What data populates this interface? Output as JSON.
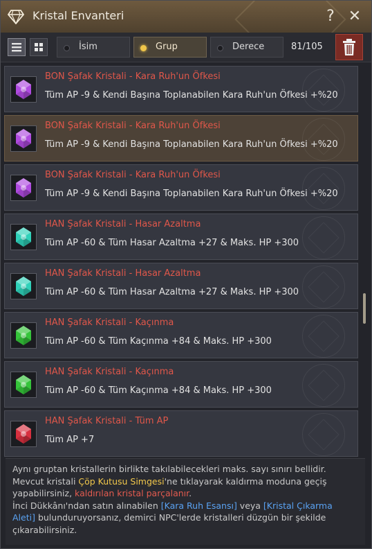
{
  "window": {
    "title": "Kristal Envanteri",
    "help_label": "?",
    "close_label": "✕"
  },
  "toolbar": {
    "view_list_icon": "list-view-icon",
    "view_grid_icon": "grid-view-icon",
    "sort_options": [
      {
        "label": "İsim",
        "selected": false
      },
      {
        "label": "Grup",
        "selected": true
      },
      {
        "label": "Derece",
        "selected": false
      }
    ],
    "count": "81/105",
    "trash_icon": "trash-icon"
  },
  "crystals": [
    {
      "name": "BON Şafak Kristali - Kara Ruh'un Öfkesi",
      "effect": "Tüm AP -9 & Kendi Başına Toplanabilen Kara Ruh'un Öfkesi +%20",
      "color": "#b04be0",
      "selected": false
    },
    {
      "name": "BON Şafak Kristali - Kara Ruh'un Öfkesi",
      "effect": "Tüm AP -9 & Kendi Başına Toplanabilen Kara Ruh'un Öfkesi +%20",
      "color": "#b04be0",
      "selected": true
    },
    {
      "name": "BON Şafak Kristali - Kara Ruh'un Öfkesi",
      "effect": "Tüm AP -9 & Kendi Başına Toplanabilen Kara Ruh'un Öfkesi +%20",
      "color": "#b04be0",
      "selected": false
    },
    {
      "name": "HAN Şafak Kristali - Hasar Azaltma",
      "effect": "Tüm AP -60 & Tüm Hasar Azaltma +27 & Maks. HP +300",
      "color": "#2fd1b9",
      "selected": false
    },
    {
      "name": "HAN Şafak Kristali - Hasar Azaltma",
      "effect": "Tüm AP -60 & Tüm Hasar Azaltma +27 & Maks. HP +300",
      "color": "#2fd1b9",
      "selected": false
    },
    {
      "name": "HAN Şafak Kristali - Kaçınma",
      "effect": "Tüm AP -60 & Tüm Kaçınma +84 & Maks. HP +300",
      "color": "#35c43a",
      "selected": false
    },
    {
      "name": "HAN Şafak Kristali - Kaçınma",
      "effect": "Tüm AP -60 & Tüm Kaçınma +84 & Maks. HP +300",
      "color": "#35c43a",
      "selected": false
    },
    {
      "name": "HAN Şafak Kristali - Tüm AP",
      "effect": "Tüm AP +7",
      "color": "#d8303f",
      "selected": false
    }
  ],
  "info": {
    "line1": "Aynı gruptan kristallerin birlikte takılabilecekleri maks. sayı sınırı bellidir.",
    "line2_pre": "Mevcut kristali ",
    "line2_hl": "Çöp Kutusu Simgesi",
    "line2_post": "'ne tıklayarak kaldırma moduna geçiş",
    "line3_pre": "yapabilirsiniz, ",
    "line3_hl": "kaldırılan kristal parçalanır",
    "line3_post": ".",
    "line4_pre": "İnci Dükkânı'ndan satın alınabilen ",
    "line4_hl1": "[Kara Ruh Esansı]",
    "line4_mid": " veya ",
    "line4_hl2": "[Kristal Çıkarma",
    "line5_hl": "Aleti]",
    "line5_post": " bulunduruyorsanız, demirci NPC'lerde kristalleri düzgün bir şekilde",
    "line6": "çıkarabilirsiniz."
  }
}
